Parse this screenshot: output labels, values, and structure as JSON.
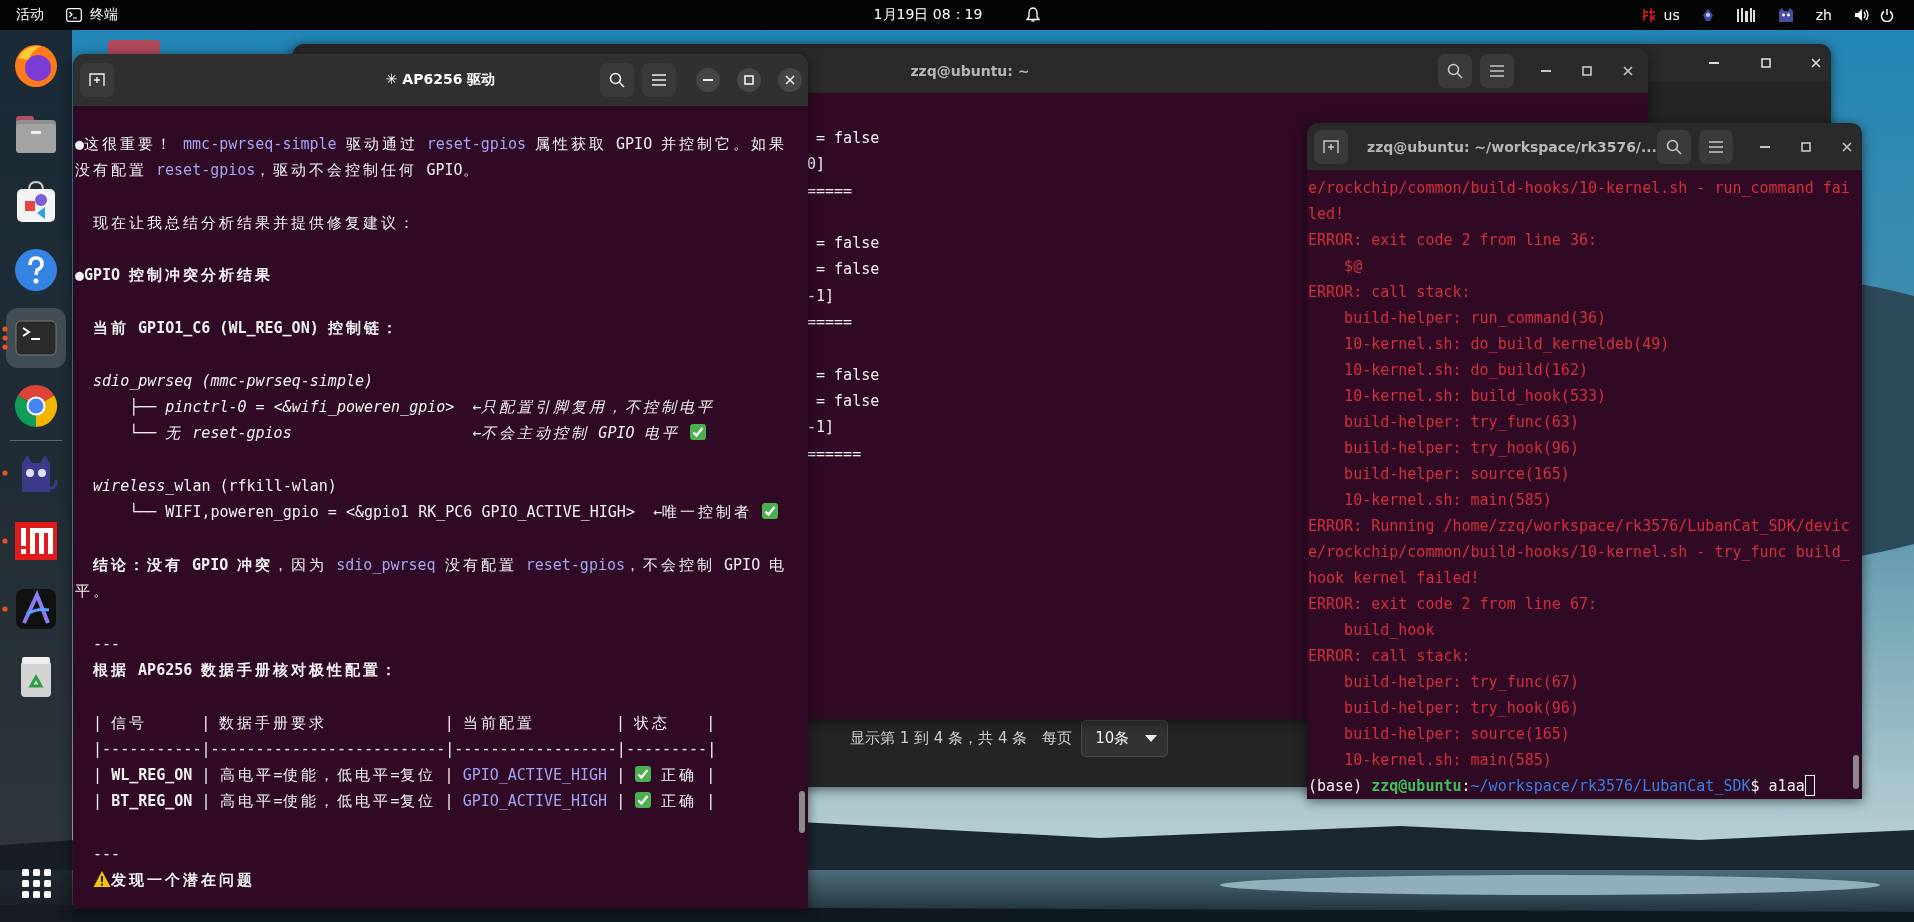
{
  "top_bar": {
    "activities": "活动",
    "app_menu": "终端",
    "clock": "1月19日 08：19",
    "keyboard_layout": "us",
    "language": "zh"
  },
  "dock": {
    "items": [
      {
        "kind": "firefox",
        "focused": false,
        "running": false,
        "separator_before": false
      },
      {
        "kind": "files",
        "focused": false,
        "running": false,
        "separator_before": false
      },
      {
        "kind": "software",
        "focused": false,
        "running": false,
        "separator_before": false
      },
      {
        "kind": "help",
        "focused": false,
        "running": false,
        "separator_before": false
      },
      {
        "kind": "terminal",
        "focused": true,
        "running": true,
        "multiple_windows": true,
        "separator_before": false
      },
      {
        "kind": "chrome",
        "focused": false,
        "running": false,
        "separator_before": false
      },
      {
        "kind": "cat",
        "focused": false,
        "running": true,
        "multiple_windows": false,
        "separator_before": true
      },
      {
        "kind": "im",
        "focused": false,
        "running": true,
        "multiple_windows": false,
        "separator_before": false
      },
      {
        "kind": "a-app",
        "focused": false,
        "running": true,
        "multiple_windows": false,
        "separator_before": false
      },
      {
        "kind": "trash",
        "focused": false,
        "running": false,
        "separator_before": false
      }
    ]
  },
  "windows": [
    {
      "kind": "browser",
      "pagination": {
        "summary": "显示第 1 到 4 条，共 4 条",
        "per_page_label": "每页",
        "per_page": "10条"
      }
    },
    {
      "kind": "terminal",
      "title": "zzq@ubuntu: ~",
      "focused": false,
      "blocks": [
        [
          [
            {
              "kind": "plain",
              "t": " = false"
            }
          ],
          [
            {
              "kind": "plain",
              "t": "0]"
            }
          ],
          [
            {
              "kind": "plain",
              "t": "====="
            }
          ]
        ],
        [
          [
            {
              "kind": "plain",
              "t": " = false"
            }
          ],
          [
            {
              "kind": "plain",
              "t": " = false"
            }
          ],
          [
            {
              "kind": "plain",
              "t": "-1]"
            }
          ],
          [
            {
              "kind": "plain",
              "t": "====="
            }
          ]
        ],
        [
          [
            {
              "kind": "plain",
              "t": " = false"
            }
          ],
          [
            {
              "kind": "plain",
              "t": " = false"
            }
          ],
          [
            {
              "kind": "plain",
              "t": "-1]"
            }
          ],
          [
            {
              "kind": "plain",
              "t": "======"
            }
          ]
        ]
      ]
    },
    {
      "kind": "terminal",
      "title": "✳ AP6256 驱动",
      "focused": true,
      "blocks": [
        [
          [
            {
              "kind": "plain",
              "t": "●这很重要！ "
            },
            {
              "kind": "code",
              "t": "mmc-pwrseq-simple"
            },
            {
              "kind": "plain",
              "t": " 驱动通过 "
            },
            {
              "kind": "code",
              "t": "reset-gpios"
            },
            {
              "kind": "plain",
              "t": " 属性获取 GPIO 并控制它。如果"
            }
          ],
          [
            {
              "kind": "plain",
              "t": "没有配置 "
            },
            {
              "kind": "code",
              "t": "reset-gpios"
            },
            {
              "kind": "plain",
              "t": "，驱动不会控制任何 GPIO。"
            }
          ]
        ],
        [
          [
            {
              "kind": "plain",
              "t": "  现在让我总结分析结果并提供修复建议："
            }
          ]
        ],
        [
          [
            {
              "kind": "plain",
              "t": "●"
            },
            {
              "kind": "bold",
              "t": "GPIO 控制冲突分析结果"
            }
          ]
        ],
        [
          [
            {
              "kind": "bold",
              "t": "  当前 GPIO1_C6 (WL_REG_ON) 控制链："
            }
          ]
        ],
        [
          [
            {
              "kind": "italic",
              "t": "  sdio_pwrseq (mmc-pwrseq-simple)"
            }
          ],
          [
            {
              "kind": "plain",
              "t": "      ├── "
            },
            {
              "kind": "italic",
              "t": "pinctrl-0 = <&wifi_poweren_gpio>  ←只配置引脚复用，不控制电平"
            }
          ],
          [
            {
              "kind": "plain",
              "t": "      └── "
            },
            {
              "kind": "italic",
              "t": "无 reset-gpios                    ←不会主动控制 GPIO 电平 "
            },
            {
              "kind": "check"
            }
          ]
        ],
        [
          [
            {
              "kind": "italic",
              "t": "  wireless"
            },
            {
              "kind": "plain",
              "t": "_wlan (rfkill-wlan)"
            }
          ],
          [
            {
              "kind": "plain",
              "t": "      └── WIFI,poweren_gpio = <&gpio1 RK_PC6 GPIO_ACTIVE_HIGH>  ←唯一控制者 "
            },
            {
              "kind": "check"
            }
          ]
        ],
        [
          [
            {
              "kind": "bold",
              "t": "  结论：没有 GPIO 冲突"
            },
            {
              "kind": "plain",
              "t": "，因为 "
            },
            {
              "kind": "code",
              "t": "sdio_pwrseq"
            },
            {
              "kind": "plain",
              "t": " 没有配置 "
            },
            {
              "kind": "code",
              "t": "reset-gpios"
            },
            {
              "kind": "plain",
              "t": "，不会控制 GPIO 电"
            }
          ],
          [
            {
              "kind": "plain",
              "t": "平。"
            }
          ]
        ],
        [
          [
            {
              "kind": "plain",
              "t": "  ---"
            }
          ],
          [
            {
              "kind": "bold",
              "t": "  根据 AP6256 数据手册核对极性配置："
            }
          ]
        ],
        [
          [
            {
              "kind": "plain",
              "t": "  | 信号      | 数据手册要求             | 当前配置         | 状态    |"
            }
          ],
          [
            {
              "kind": "plain",
              "t": "  |-----------|--------------------------|------------------|---------|"
            }
          ],
          [
            {
              "kind": "plain",
              "t": "  | "
            },
            {
              "kind": "bold",
              "t": "WL_REG_ON"
            },
            {
              "kind": "plain",
              "t": " | 高电平=使能，低电平=复位 | "
            },
            {
              "kind": "code",
              "t": "GPIO_ACTIVE_HIGH"
            },
            {
              "kind": "plain",
              "t": " | "
            },
            {
              "kind": "check"
            },
            {
              "kind": "plain",
              "t": " 正确 |"
            }
          ],
          [
            {
              "kind": "plain",
              "t": "  | "
            },
            {
              "kind": "bold",
              "t": "BT_REG_ON"
            },
            {
              "kind": "plain",
              "t": " | 高电平=使能，低电平=复位 | "
            },
            {
              "kind": "code",
              "t": "GPIO_ACTIVE_HIGH"
            },
            {
              "kind": "plain",
              "t": " | "
            },
            {
              "kind": "check"
            },
            {
              "kind": "plain",
              "t": " 正确 |"
            }
          ]
        ],
        [
          [
            {
              "kind": "plain",
              "t": "  ---"
            }
          ],
          [
            {
              "kind": "warning"
            },
            {
              "kind": "bold",
              "t": "发现一个潜在问题"
            }
          ]
        ]
      ]
    },
    {
      "kind": "terminal",
      "title": "zzq@ubuntu: ~/workspace/rk3576/...",
      "focused": false,
      "cursor": true,
      "blocks": [
        [
          [
            {
              "kind": "error",
              "t": "e/rockchip/common/build-hooks/10-kernel.sh - run_command fai"
            }
          ],
          [
            {
              "kind": "error",
              "t": "led!"
            }
          ],
          [
            {
              "kind": "error",
              "t": "ERROR: exit code 2 from line 36:"
            }
          ],
          [
            {
              "kind": "error",
              "t": "    $@"
            }
          ],
          [
            {
              "kind": "error",
              "t": "ERROR: call stack:"
            }
          ],
          [
            {
              "kind": "error",
              "t": "    build-helper: run_command(36)"
            }
          ],
          [
            {
              "kind": "error",
              "t": "    10-kernel.sh: do_build_kerneldeb(49)"
            }
          ],
          [
            {
              "kind": "error",
              "t": "    10-kernel.sh: do_build(162)"
            }
          ],
          [
            {
              "kind": "error",
              "t": "    10-kernel.sh: build_hook(533)"
            }
          ],
          [
            {
              "kind": "error",
              "t": "    build-helper: try_func(63)"
            }
          ],
          [
            {
              "kind": "error",
              "t": "    build-helper: try_hook(96)"
            }
          ],
          [
            {
              "kind": "error",
              "t": "    build-helper: source(165)"
            }
          ],
          [
            {
              "kind": "error",
              "t": "    10-kernel.sh: main(585)"
            }
          ],
          [
            {
              "kind": "error",
              "t": "ERROR: Running /home/zzq/workspace/rk3576/LubanCat_SDK/devic"
            }
          ],
          [
            {
              "kind": "error",
              "t": "e/rockchip/common/build-hooks/10-kernel.sh - try_func build_"
            }
          ],
          [
            {
              "kind": "error",
              "t": "hook kernel failed!"
            }
          ],
          [
            {
              "kind": "error",
              "t": "ERROR: exit code 2 from line 67:"
            }
          ],
          [
            {
              "kind": "error",
              "t": "    build_hook"
            }
          ],
          [
            {
              "kind": "error",
              "t": "ERROR: call stack:"
            }
          ],
          [
            {
              "kind": "error",
              "t": "    build-helper: try_func(67)"
            }
          ],
          [
            {
              "kind": "error",
              "t": "    build-helper: try_hook(96)"
            }
          ],
          [
            {
              "kind": "error",
              "t": "    build-helper: source(165)"
            }
          ],
          [
            {
              "kind": "error",
              "t": "    10-kernel.sh: main(585)"
            }
          ],
          [
            {
              "kind": "plain",
              "t": "(base) "
            },
            {
              "kind": "user",
              "t": "zzq@ubuntu"
            },
            {
              "kind": "plain",
              "t": ":"
            },
            {
              "kind": "path",
              "t": "~/workspace/rk3576/LubanCat_SDK"
            },
            {
              "kind": "plain",
              "t": "$ a1aa"
            }
          ]
        ]
      ]
    }
  ]
}
